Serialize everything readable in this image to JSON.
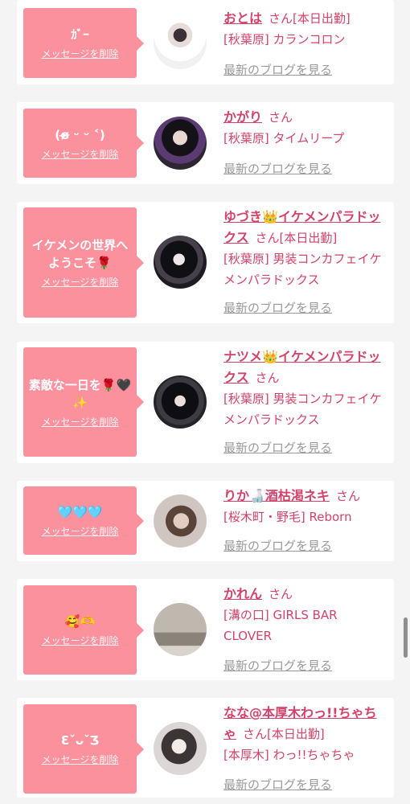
{
  "delete_label": "メッセージを削除",
  "blog_label": "最新のブログを見る",
  "san_label": "さん",
  "items": [
    {
      "message": "ｶﾞｰ",
      "name": "おとは",
      "status": "[本日出勤]",
      "area": "[秋葉原]",
      "shop": "カランコロン"
    },
    {
      "message": "(ɞ̴̶̷ ᵕ ᵕ ˂)",
      "name": "かがり",
      "status": "",
      "area": "[秋葉原]",
      "shop": "タイムリープ"
    },
    {
      "message": "イケメンの世界へようこそ🌹",
      "name": "ゆづき👑イケメンパラドックス",
      "status": "[本日出勤]",
      "area": "[秋葉原]",
      "shop": "男装コンカフェイケメンパラドックス"
    },
    {
      "message": "素敵な一日を🌹🖤✨",
      "name": "ナツメ👑イケメンパラドックス",
      "status": "",
      "area": "[秋葉原]",
      "shop": "男装コンカフェイケメンパラドックス"
    },
    {
      "message": "🩵🩵🩵",
      "name": "りか🍶酒枯渇ネキ",
      "status": "",
      "area": "[桜木町・野毛]",
      "shop": "Reborn"
    },
    {
      "message": "🥰🫶",
      "name": "かれん",
      "status": "",
      "area": "[溝の口]",
      "shop": "GIRLS BAR CLOVER"
    },
    {
      "message": "ƐˇᴗˇƷ",
      "name": "なな@本厚木わっ!!ちゃちゃ",
      "status": "[本日出勤]",
      "area": "[本厚木]",
      "shop": "わっ!!ちゃちゃ"
    }
  ]
}
